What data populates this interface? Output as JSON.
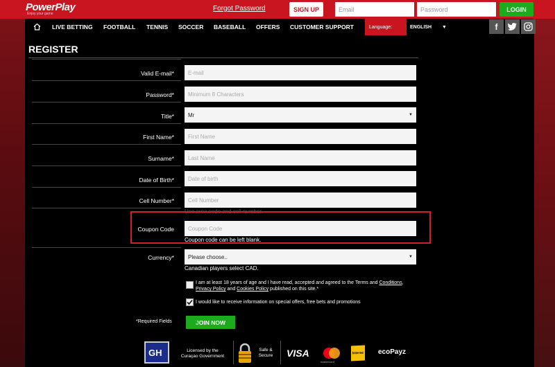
{
  "header": {
    "logo": "PowerPlay",
    "tagline": "Enjoy your game",
    "forgot_password": "Forgot Password",
    "signup_label": "SIGN UP",
    "email_placeholder": "Email",
    "password_placeholder": "Password",
    "login_label": "LOGIN"
  },
  "nav": {
    "items": [
      "LIVE BETTING",
      "FOOTBALL",
      "TENNIS",
      "SOCCER",
      "BASEBALL",
      "OFFERS",
      "CUSTOMER SUPPORT"
    ],
    "language_label": "Language:",
    "language_value": "ENGLISH",
    "social": [
      "f",
      "t",
      "ig"
    ]
  },
  "form": {
    "title": "REGISTER",
    "fields": [
      {
        "label": "Valid E-mail*",
        "placeholder": "E-mail"
      },
      {
        "label": "Password*",
        "placeholder": "Minimum 8 Characters"
      },
      {
        "label": "Title*",
        "value": "Mr"
      },
      {
        "label": "First Name*",
        "placeholder": "First Name"
      },
      {
        "label": "Surname*",
        "placeholder": "Last Name"
      },
      {
        "label": "Date of Birth*",
        "placeholder": "Date of birth"
      },
      {
        "label": "Cell Number*",
        "placeholder": "Cell Number"
      },
      {
        "label": "Coupon Code",
        "placeholder": "Coupon Code"
      },
      {
        "label": "Currency*",
        "value": "Please choose.."
      }
    ],
    "cell_hint": "Use area code and cell number.",
    "coupon_hint": "Coupon code can be left blank.",
    "currency_hint": "Canadian players select CAD.",
    "terms_prefix": "I am at least 18 years of age and I have read, accepted and agreed to the Terms and",
    "terms_conditions": "Conditions",
    "terms_privacy": "Privacy Policy",
    "terms_and": "and",
    "terms_cookies": "Cookies Policy",
    "terms_suffix": "published on this site.*",
    "promo_text": "I would like to receive information on special offers, free bets and promotions",
    "terms_checked": false,
    "promo_checked": true,
    "required_note": "*Required Fields",
    "join_label": "JOIN NOW"
  },
  "footer": {
    "licensed_line1": "Licensed by the",
    "licensed_line2": "Curaçao Government",
    "safe_line1": "Safe &",
    "safe_line2": "Secure",
    "visa": "VISA",
    "mastercard": "mastercard",
    "interac": "Interac",
    "ecopayz": "ecoPayz"
  },
  "colors": {
    "brand_red": "#c8151f",
    "green": "#1cab1c",
    "highlight_red": "#d0202a"
  }
}
